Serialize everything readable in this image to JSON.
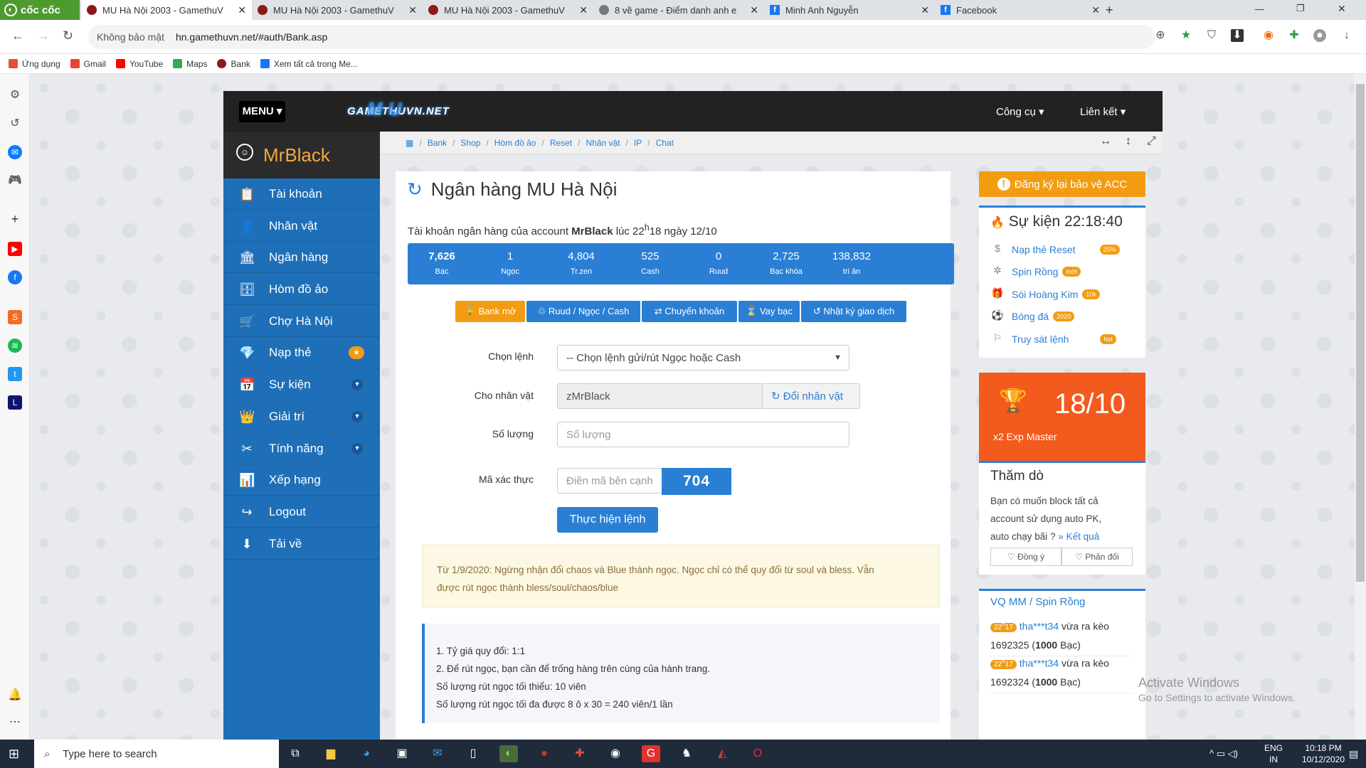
{
  "browser": {
    "brand": "cốc cốc",
    "tabs": [
      {
        "title": "MU Hà Nội 2003 - GamethuV",
        "active": true
      },
      {
        "title": "MU Hà Nội 2003 - GamethuV",
        "active": false
      },
      {
        "title": "MU Hà Nội 2003 - GamethuV",
        "active": false
      },
      {
        "title": "8 về game - Điểm danh anh e",
        "active": false
      },
      {
        "title": "Minh Anh Nguyễn",
        "active": false
      },
      {
        "title": "Facebook",
        "active": false
      }
    ],
    "security": "Không bảo mật",
    "url": "hn.gamethuvn.net/#auth/Bank.asp",
    "bookmarks": [
      "Ứng dụng",
      "Gmail",
      "YouTube",
      "Maps",
      "Bank",
      "Xem tất cả trong Me..."
    ]
  },
  "site": {
    "menu_label": "MENU ▾",
    "logo_text": "GAMETHUVN.NET",
    "logo_mu": "MU",
    "header_links": [
      "Công cụ ▾",
      "Liên kết ▾"
    ],
    "username": "MrBlack",
    "sidebar": [
      {
        "label": "Tài khoản",
        "icon": "📋"
      },
      {
        "label": "Nhân vật",
        "icon": "👤"
      },
      {
        "label": "Ngân hàng",
        "icon": "🏛"
      },
      {
        "label": "Hòm đồ ảo",
        "icon": "🗄"
      },
      {
        "label": "Chợ Hà Nội",
        "icon": "🛒"
      },
      {
        "label": "Nạp thẻ",
        "icon": "💎"
      },
      {
        "label": "Sự kiện",
        "icon": "📅"
      },
      {
        "label": "Giải trí",
        "icon": "👑"
      },
      {
        "label": "Tính năng",
        "icon": "✂"
      },
      {
        "label": "Xếp hạng",
        "icon": "📊"
      },
      {
        "label": "Logout",
        "icon": "↪"
      },
      {
        "label": "Tải về",
        "icon": "⬇"
      }
    ],
    "breadcrumb": [
      "Bank",
      "Shop",
      "Hòm đồ ảo",
      "Reset",
      "Nhân vật",
      "IP",
      "Chat"
    ]
  },
  "bank": {
    "title": "Ngân hàng MU Hà Nội",
    "account_prefix": "Tài khoản ngân hàng của account ",
    "account_name": "MrBlack",
    "account_suffix_a": " lúc 22",
    "account_sup": "h",
    "account_suffix_b": "18 ngày 12/10",
    "stats": [
      {
        "value": "7,626",
        "label": "Bạc"
      },
      {
        "value": "1",
        "label": "Ngọc"
      },
      {
        "value": "4,804",
        "label": "Tr.zen"
      },
      {
        "value": "525",
        "label": "Cash"
      },
      {
        "value": "0",
        "label": "Ruud"
      },
      {
        "value": "2,725",
        "label": "Bạc khóa"
      },
      {
        "value": "138,832",
        "label": "tri ân"
      }
    ],
    "actions": [
      "🔓 Bank mở",
      "♲ Ruud / Ngọc / Cash",
      "⇄ Chuyển khoản",
      "⌛ Vay bạc",
      "↺ Nhật ký giao dịch"
    ],
    "form": {
      "command_label": "Chọn lệnh",
      "command_value": "-- Chọn lệnh gửi/rút Ngọc hoặc Cash",
      "character_label": "Cho nhân vật",
      "character_value": "zMrBlack",
      "change_char": "↻ Đổi nhân vật",
      "quantity_label": "Số lượng",
      "quantity_placeholder": "Số lượng",
      "captcha_label": "Mã xác thực",
      "captcha_placeholder": "Điền mã bên cạnh",
      "captcha_code": "704",
      "submit": "Thực hiện lệnh"
    },
    "notice_lines": [
      "Từ 1/9/2020: Ngừng nhận đổi chaos và Blue thành ngọc. Ngọc chỉ có thể quy đổi từ soul và bless. Vẫn",
      "được rút ngọc thành bless/soul/chaos/blue"
    ],
    "info_lines": [
      "1. Tỷ giá quy đổi: 1:1",
      "2. Để rút ngọc, bạn cần để trống hàng trên cùng của hành trang.",
      "Số lượng rút ngọc tối thiểu: 10 viên",
      "Số lượng rút ngọc tối đa được 8 ô x 30 = 240 viên/1 lần"
    ]
  },
  "right": {
    "register_btn": "Đăng ký lại bảo vệ ACC",
    "event_title": "Sự kiện 22:18:40",
    "events": [
      {
        "label": "Nạp thẻ Reset",
        "badge": "25%"
      },
      {
        "label": "Spin Rồng",
        "badge": "mới"
      },
      {
        "label": "Sói Hoàng Kim",
        "badge": "10k"
      },
      {
        "label": "Bóng đá",
        "badge": "2020"
      },
      {
        "label": "Truy sát lệnh",
        "badge": "hot"
      }
    ],
    "exp_value": "18/10",
    "exp_label": "x2 Exp Master",
    "poll_title": "Thăm dò",
    "poll_text_1": "Bạn có muốn block tất cả",
    "poll_text_2": "account sử dụng auto PK,",
    "poll_text_3": "auto chạy bãi ? ",
    "poll_result": "» Kết quả",
    "poll_yes": "♡ Đồng ý",
    "poll_no": "♡ Phản đối",
    "vq_title": "VQ MM / Spin Rồng",
    "vq_items": [
      {
        "time_a": "22",
        "time_sup": "h",
        "time_b": "17",
        "user": "tha***t34",
        "text": " vừa ra kèo",
        "line2_a": "1692325 (",
        "amount": "1000",
        "line2_b": " Bạc)"
      },
      {
        "time_a": "22",
        "time_sup": "h",
        "time_b": "17",
        "user": "tha***t34",
        "text": " vừa ra kèo",
        "line2_a": "1692324 (",
        "amount": "1000",
        "line2_b": " Bạc)"
      }
    ],
    "watermark_1": "Activate Windows",
    "watermark_2": "Go to Settings to activate Windows."
  },
  "taskbar": {
    "search": "Type here to search",
    "lang_1": "ENG",
    "lang_2": "IN",
    "time": "10:18 PM",
    "date": "10/12/2020"
  }
}
